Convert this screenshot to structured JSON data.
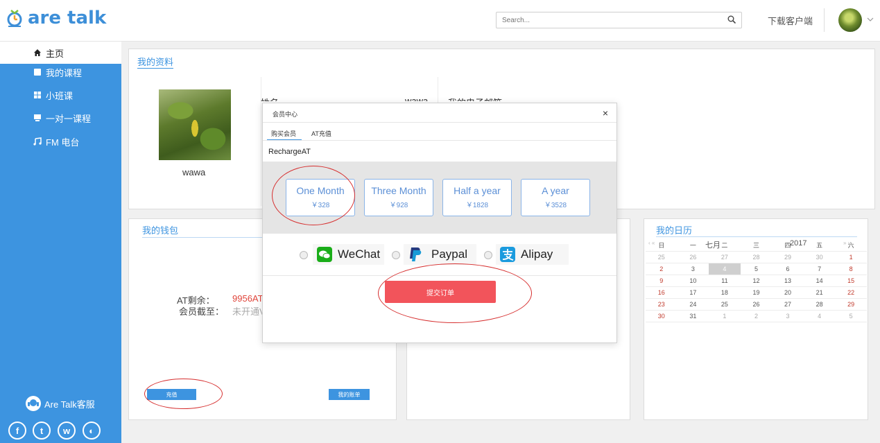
{
  "app": {
    "brand": "are talk"
  },
  "header": {
    "search_placeholder": "Search...",
    "download_label": "下载客户端"
  },
  "sidebar": {
    "items": [
      {
        "label": "主页",
        "icon": "home-icon",
        "active": true
      },
      {
        "label": "我的课程",
        "icon": "book-icon"
      },
      {
        "label": "小班课",
        "icon": "grid-icon"
      },
      {
        "label": "一对一课程",
        "icon": "board-icon"
      },
      {
        "label": "FM 电台",
        "icon": "music-icon"
      }
    ],
    "service_label": "Are Talk客服",
    "social": [
      "facebook-icon",
      "twitter-icon",
      "weibo-icon",
      "wechat-icon"
    ]
  },
  "profile": {
    "title": "我的资料",
    "name_under_photo": "wawa",
    "name_label_partial": "姓名",
    "name_value_partial": "wawa",
    "email_label_partial": "我的电子邮箱"
  },
  "wallet": {
    "title": "我的钱包",
    "at_label": "AT剩余：",
    "at_value": "9956AT",
    "member_label": "会员截至：",
    "member_value": "未开通V",
    "recharge_button": "充值",
    "bill_button": "我的账单"
  },
  "calendar": {
    "title": "我的日历",
    "month": "七月",
    "year": "2017",
    "nav_prev": "‹ «",
    "nav_next": "» ›",
    "weekdays": [
      "日",
      "一",
      "二",
      "三",
      "四",
      "五",
      "六"
    ],
    "weeks": [
      [
        "25",
        "26",
        "27",
        "28",
        "29",
        "30",
        "1"
      ],
      [
        "2",
        "3",
        "4",
        "5",
        "6",
        "7",
        "8"
      ],
      [
        "9",
        "10",
        "11",
        "12",
        "13",
        "14",
        "15"
      ],
      [
        "16",
        "17",
        "18",
        "19",
        "20",
        "21",
        "22"
      ],
      [
        "23",
        "24",
        "25",
        "26",
        "27",
        "28",
        "29"
      ],
      [
        "30",
        "31",
        "1",
        "2",
        "3",
        "4",
        "5"
      ]
    ],
    "today": "4"
  },
  "modal": {
    "title": "会员中心",
    "close": "×",
    "tabs": [
      "购买会员",
      "AT充值"
    ],
    "section_label": "RechargeAT",
    "plans": [
      {
        "name": "One Month",
        "price": "￥328"
      },
      {
        "name": "Three Month",
        "price": "￥928"
      },
      {
        "name": "Half a year",
        "price": "￥1828"
      },
      {
        "name": "A year",
        "price": "￥3528"
      }
    ],
    "payments": [
      "WeChat",
      "Paypal",
      "Alipay"
    ],
    "submit_label": "提交订单"
  },
  "colors": {
    "primary": "#3d94e0",
    "submit": "#f2545b",
    "annotation": "#d62e2e"
  }
}
